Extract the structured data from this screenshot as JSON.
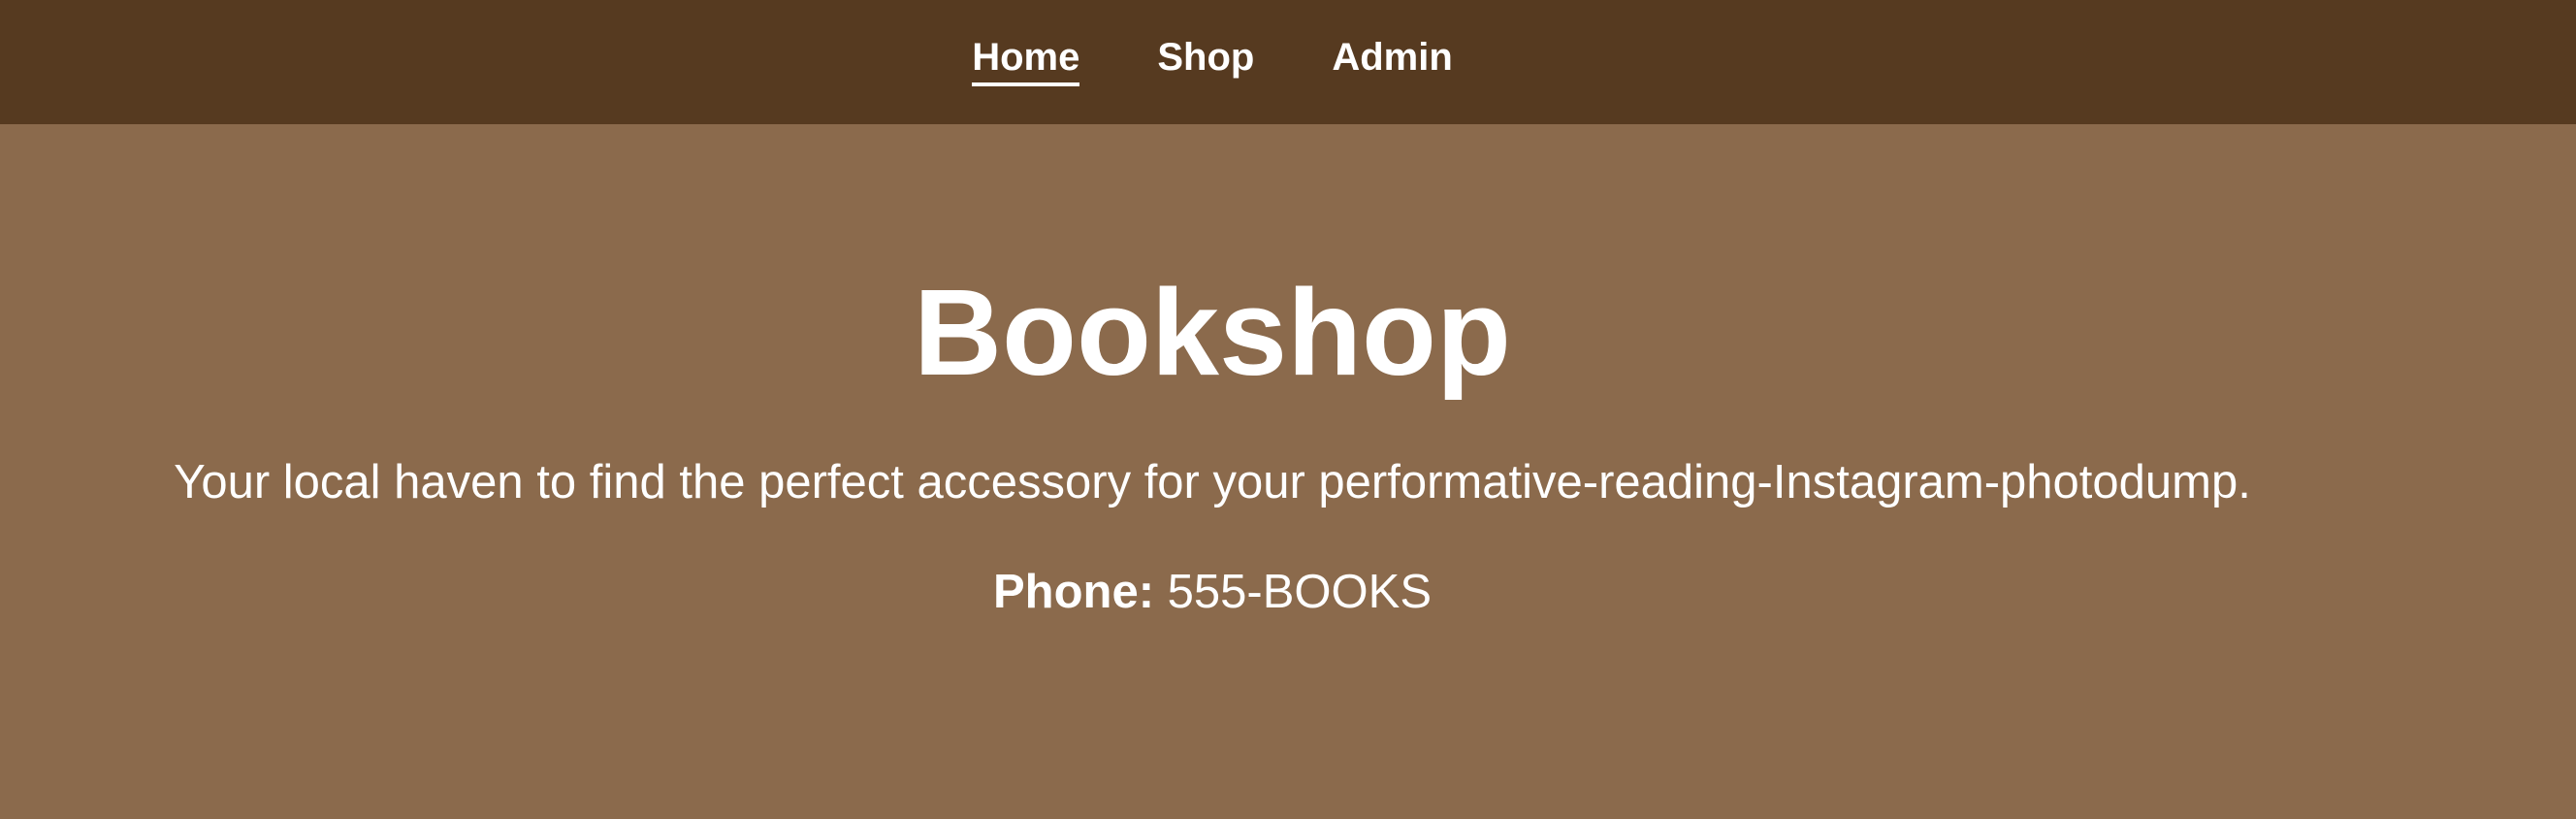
{
  "theme": {
    "topbar_color": "#563a20",
    "background_color": "#8b6a4c",
    "text_color": "#ffffff"
  },
  "nav": {
    "items": [
      {
        "label": "Home",
        "active": true
      },
      {
        "label": "Shop",
        "active": false
      },
      {
        "label": "Admin",
        "active": false
      }
    ]
  },
  "hero": {
    "title": "Bookshop",
    "tagline": "Your local haven to find the perfect accessory for your performative-reading-Instagram-photodump.",
    "phone_label": "Phone:",
    "phone_value": "555-BOOKS"
  }
}
